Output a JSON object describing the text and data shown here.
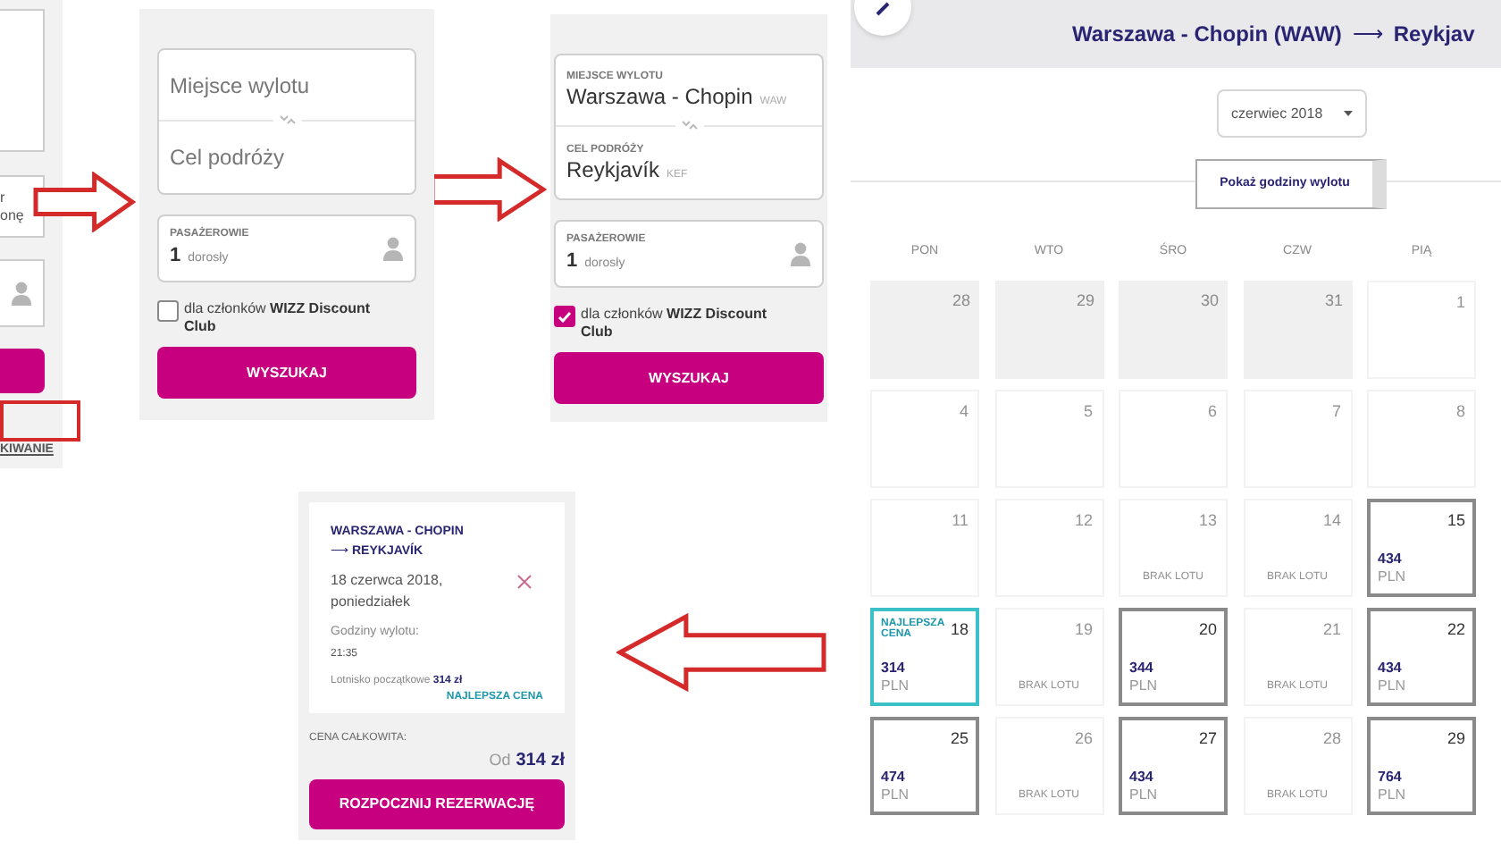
{
  "left_fragment": {
    "texts": [
      "r",
      "onę"
    ],
    "link": "KIWANIE"
  },
  "search_forms": [
    {
      "origin": {
        "placeholder": "Miejsce wylotu"
      },
      "destination": {
        "placeholder": "Cel podróży"
      },
      "passengers": {
        "label": "PASAŻEROWIE",
        "count": "1",
        "unit": "dorosły"
      },
      "club": {
        "text": "dla członków **WIZZ Discount Club**",
        "checked": false
      },
      "button": "WYSZUKAJ"
    },
    {
      "origin": {
        "label": "MIEJSCE WYLOTU",
        "value": "Warszawa - Chopin",
        "code": "WAW"
      },
      "destination": {
        "label": "CEL PODRÓŻY",
        "value": "Reykjavík",
        "code": "KEF"
      },
      "passengers": {
        "label": "PASAŻEROWIE",
        "count": "1",
        "unit": "dorosły"
      },
      "club": {
        "text": "dla członków **WIZZ Discount Club**",
        "checked": true
      },
      "button": "WYSZUKAJ"
    }
  ],
  "calendar": {
    "route": {
      "from": "Warszawa - Chopin (WAW)",
      "arrow": "⟶",
      "to": "Reykjav"
    },
    "month": "czerwiec 2018",
    "hours_button": "Pokaż godziny wylotu",
    "weekdays": [
      "PON",
      "WTO",
      "ŚRO",
      "CZW",
      "PIĄ"
    ],
    "weeks": [
      [
        {
          "kind": "past",
          "day": "28"
        },
        {
          "kind": "past",
          "day": "29"
        },
        {
          "kind": "past",
          "day": "30"
        },
        {
          "kind": "past",
          "day": "31"
        },
        {
          "kind": "empty",
          "day": "1"
        }
      ],
      [
        {
          "kind": "empty",
          "day": "4"
        },
        {
          "kind": "empty",
          "day": "5"
        },
        {
          "kind": "empty",
          "day": "6"
        },
        {
          "kind": "empty",
          "day": "7"
        },
        {
          "kind": "empty",
          "day": "8"
        }
      ],
      [
        {
          "kind": "empty",
          "day": "11"
        },
        {
          "kind": "empty",
          "day": "12"
        },
        {
          "kind": "no_flight",
          "day": "13",
          "note": "BRAK LOTU"
        },
        {
          "kind": "no_flight",
          "day": "14",
          "note": "BRAK LOTU"
        },
        {
          "kind": "price",
          "day": "15",
          "price": "434",
          "currency": "PLN",
          "selected": false
        }
      ],
      [
        {
          "kind": "price",
          "day": "18",
          "badge": "NAJLEPSZA CENA",
          "price": "314",
          "currency": "PLN",
          "selected": true
        },
        {
          "kind": "no_flight",
          "day": "19",
          "note": "BRAK LOTU"
        },
        {
          "kind": "price",
          "day": "20",
          "price": "344",
          "currency": "PLN",
          "selected": false
        },
        {
          "kind": "no_flight",
          "day": "21",
          "note": "BRAK LOTU"
        },
        {
          "kind": "price",
          "day": "22",
          "price": "434",
          "currency": "PLN",
          "selected": false
        }
      ],
      [
        {
          "kind": "price",
          "day": "25",
          "price": "474",
          "currency": "PLN",
          "selected": false
        },
        {
          "kind": "no_flight",
          "day": "26",
          "note": "BRAK LOTU"
        },
        {
          "kind": "price",
          "day": "27",
          "price": "434",
          "currency": "PLN",
          "selected": false
        },
        {
          "kind": "no_flight",
          "day": "28",
          "note": "BRAK LOTU"
        },
        {
          "kind": "price",
          "day": "29",
          "price": "764",
          "currency": "PLN",
          "selected": false
        }
      ]
    ]
  },
  "summary": {
    "route_from": "WARSZAWA - CHOPIN",
    "route_arrow": "⟶",
    "route_to": "REYKJAVÍK",
    "date": "18 czerwca 2018, poniedziałek",
    "times_label": "Godziny wylotu:",
    "time": "21:35",
    "airport_text": "Lotnisko początkowe **314 zł**",
    "best_badge": "NAJLEPSZA CENA",
    "total_label": "CENA CAŁKOWITA:",
    "total_prefix": "Od",
    "total": "314 zł",
    "button": "ROZPOCZNIJ REZERWACJĘ"
  }
}
